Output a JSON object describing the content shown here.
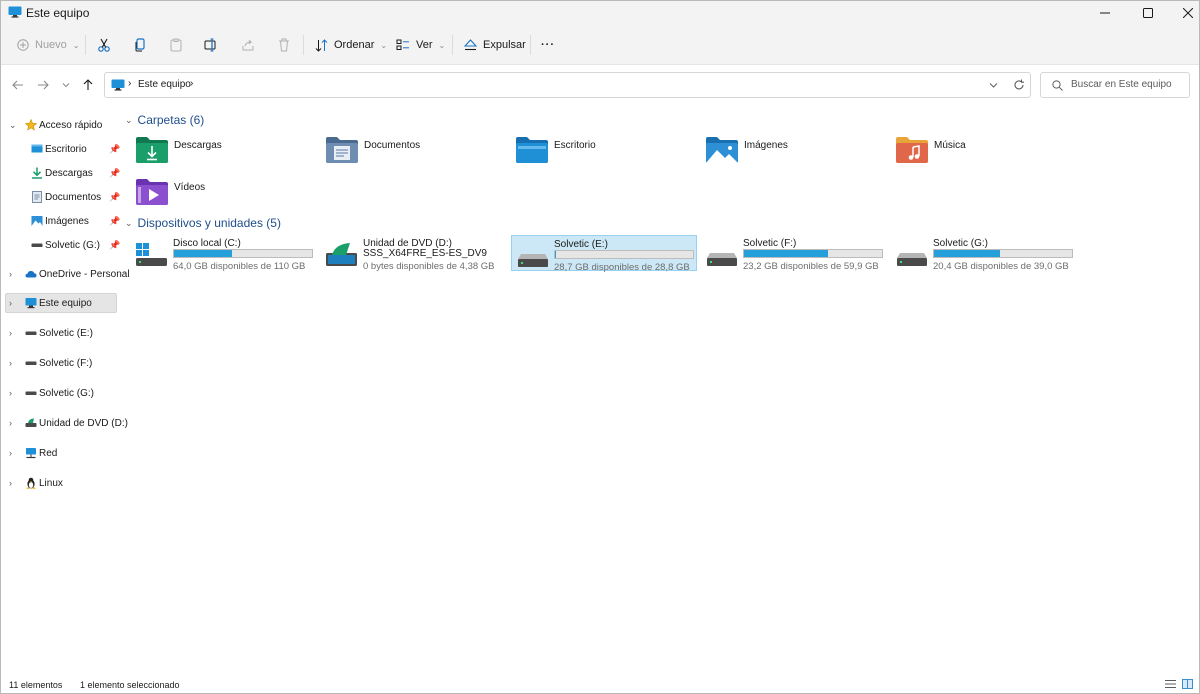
{
  "window": {
    "title": "Este equipo"
  },
  "toolbar": {
    "new_label": "Nuevo",
    "sort_label": "Ordenar",
    "view_label": "Ver",
    "eject_label": "Expulsar",
    "more_label": "···"
  },
  "address": {
    "segment": "Este equipo",
    "search_placeholder": "Buscar en Este equipo"
  },
  "sidebar": {
    "quick_access": "Acceso rápido",
    "quick_items": [
      {
        "label": "Escritorio",
        "icon": "desktop-icon"
      },
      {
        "label": "Descargas",
        "icon": "download-icon"
      },
      {
        "label": "Documentos",
        "icon": "document-icon"
      },
      {
        "label": "Imágenes",
        "icon": "pictures-icon"
      },
      {
        "label": "Solvetic (G:)",
        "icon": "drive-icon"
      }
    ],
    "items": [
      {
        "label": "OneDrive - Personal",
        "icon": "cloud-icon"
      },
      {
        "label": "Este equipo",
        "icon": "computer-icon"
      },
      {
        "label": "Solvetic (E:)",
        "icon": "drive-icon"
      },
      {
        "label": "Solvetic (F:)",
        "icon": "drive-icon"
      },
      {
        "label": "Solvetic (G:)",
        "icon": "drive-icon"
      },
      {
        "label": "Unidad de DVD (D:)",
        "icon": "dvd-icon"
      },
      {
        "label": "Red",
        "icon": "network-icon"
      },
      {
        "label": "Linux",
        "icon": "linux-icon"
      }
    ]
  },
  "folders": {
    "header": "Carpetas (6)",
    "items": [
      {
        "name": "Descargas",
        "color": "#1a9e6a"
      },
      {
        "name": "Documentos",
        "color": "#5a7fa8"
      },
      {
        "name": "Escritorio",
        "color": "#1f8fd6"
      },
      {
        "name": "Imágenes",
        "color": "#2d8fd6"
      },
      {
        "name": "Música",
        "color": "#e0674a"
      },
      {
        "name": "Vídeos",
        "color": "#8b4fd0"
      }
    ]
  },
  "drives": {
    "header": "Dispositivos y unidades (5)",
    "items": [
      {
        "name": "Disco local (C:)",
        "free_text": "64,0 GB disponibles de 110 GB",
        "used_fraction": 0.42
      },
      {
        "name": "Unidad de DVD (D:)",
        "name2": "SSS_X64FRE_ES-ES_DV9",
        "free_text": "0 bytes disponibles de 4,38 GB"
      },
      {
        "name": "Solvetic (E:)",
        "free_text": "28,7 GB disponibles de 28,8 GB",
        "used_fraction": 0.003
      },
      {
        "name": "Solvetic (F:)",
        "free_text": "23,2 GB disponibles de 59,9 GB",
        "used_fraction": 0.61
      },
      {
        "name": "Solvetic (G:)",
        "free_text": "20,4 GB disponibles de 39,0 GB",
        "used_fraction": 0.48
      }
    ]
  },
  "status": {
    "count": "11 elementos",
    "selection": "1 elemento seleccionado"
  },
  "colors": {
    "accent": "#26a0da",
    "selection": "#cce8f6",
    "header_text": "#1f4e8c"
  }
}
